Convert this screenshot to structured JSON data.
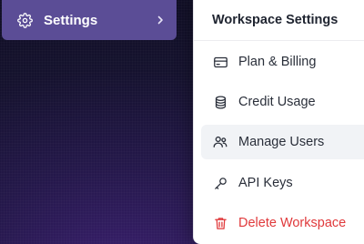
{
  "nav": {
    "settings": {
      "label": "Settings",
      "icon": "gear-icon",
      "chevron": "chevron-right-icon"
    }
  },
  "menu": {
    "title": "Workspace Settings",
    "items": [
      {
        "label": "Plan & Billing",
        "icon": "credit-card-icon"
      },
      {
        "label": "Credit Usage",
        "icon": "coins-icon"
      },
      {
        "label": "Manage Users",
        "icon": "users-icon",
        "state": "hover"
      },
      {
        "label": "API Keys",
        "icon": "key-icon"
      },
      {
        "label": "Delete Workspace",
        "icon": "trash-icon",
        "state": "danger"
      }
    ]
  },
  "colors": {
    "settings_bg": "#5b4d96",
    "danger": "#e0393b",
    "hover_bg": "#f1f3f6",
    "text": "#2a2f3a"
  }
}
